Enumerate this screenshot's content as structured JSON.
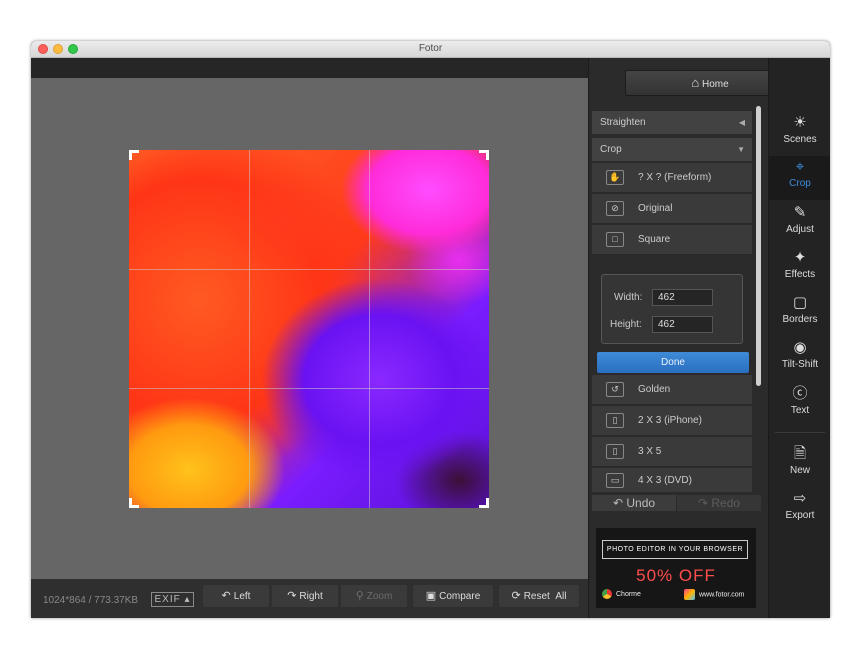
{
  "window": {
    "title": "Fotor"
  },
  "status": {
    "dimensions": "1024*864 / 773.37KB",
    "exif_label": "EXIF ▴"
  },
  "bottom_toolbar": {
    "left": "Left",
    "right": "Right",
    "zoom": "Zoom",
    "compare": "Compare",
    "reset": "Reset",
    "all": "All"
  },
  "panel": {
    "home": "Home",
    "straighten": "Straighten",
    "crop": "Crop",
    "ratios_top": [
      "? X ? (Freeform)",
      "Original",
      "Square"
    ],
    "width_label": "Width:",
    "width_value": "462",
    "height_label": "Height:",
    "height_value": "462",
    "done": "Done",
    "ratios_bottom": [
      "Golden",
      "2 X 3 (iPhone)",
      "3 X 5",
      "4 X 3 (DVD)"
    ],
    "undo": "Undo",
    "redo": "Redo"
  },
  "ad": {
    "headline": "PHOTO EDITOR IN YOUR BROWSER",
    "offer": "50% OFF",
    "browser": "Chorme",
    "site": "www.fotor.com"
  },
  "rail": {
    "scenes": "Scenes",
    "crop": "Crop",
    "adjust": "Adjust",
    "effects": "Effects",
    "borders": "Borders",
    "tilt_shift": "Tilt-Shift",
    "text": "Text",
    "new": "New",
    "export": "Export"
  },
  "colors": {
    "accent": "#3d8fe0",
    "done_button": "#2f7bcc",
    "ad_offer": "#ff4d4d"
  }
}
